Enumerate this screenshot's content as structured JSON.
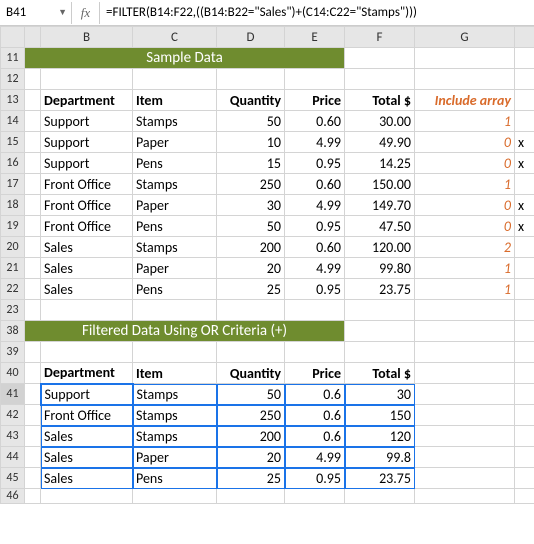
{
  "namebox": "B41",
  "formula": "=FILTER(B14:F22,((B14:B22=\"Sales\")+(C14:C22=\"Stamps\")))",
  "fx_label": "fx",
  "col_headers": [
    "B",
    "C",
    "D",
    "E",
    "F",
    "G"
  ],
  "banner1": "Sample Data",
  "banner2": "Filtered Data Using OR Criteria (+)",
  "headers": {
    "dept": "Department",
    "item": "Item",
    "qty": "Quantity",
    "price": "Price",
    "total": "Total $",
    "include": "Include array"
  },
  "sample": [
    {
      "row": "14",
      "dept": "Support",
      "item": "Stamps",
      "qty": "50",
      "price": "0.60",
      "total": "30.00",
      "incl": "1",
      "x": ""
    },
    {
      "row": "15",
      "dept": "Support",
      "item": "Paper",
      "qty": "10",
      "price": "4.99",
      "total": "49.90",
      "incl": "0",
      "x": "x"
    },
    {
      "row": "16",
      "dept": "Support",
      "item": "Pens",
      "qty": "15",
      "price": "0.95",
      "total": "14.25",
      "incl": "0",
      "x": "x"
    },
    {
      "row": "17",
      "dept": "Front Office",
      "item": "Stamps",
      "qty": "250",
      "price": "0.60",
      "total": "150.00",
      "incl": "1",
      "x": ""
    },
    {
      "row": "18",
      "dept": "Front Office",
      "item": "Paper",
      "qty": "30",
      "price": "4.99",
      "total": "149.70",
      "incl": "0",
      "x": "x"
    },
    {
      "row": "19",
      "dept": "Front Office",
      "item": "Pens",
      "qty": "50",
      "price": "0.95",
      "total": "47.50",
      "incl": "0",
      "x": "x"
    },
    {
      "row": "20",
      "dept": "Sales",
      "item": "Stamps",
      "qty": "200",
      "price": "0.60",
      "total": "120.00",
      "incl": "2",
      "x": ""
    },
    {
      "row": "21",
      "dept": "Sales",
      "item": "Paper",
      "qty": "20",
      "price": "4.99",
      "total": "99.80",
      "incl": "1",
      "x": ""
    },
    {
      "row": "22",
      "dept": "Sales",
      "item": "Pens",
      "qty": "25",
      "price": "0.95",
      "total": "23.75",
      "incl": "1",
      "x": ""
    }
  ],
  "filtered": [
    {
      "row": "41",
      "dept": "Support",
      "item": "Stamps",
      "qty": "50",
      "price": "0.6",
      "total": "30"
    },
    {
      "row": "42",
      "dept": "Front Office",
      "item": "Stamps",
      "qty": "250",
      "price": "0.6",
      "total": "150"
    },
    {
      "row": "43",
      "dept": "Sales",
      "item": "Stamps",
      "qty": "200",
      "price": "0.6",
      "total": "120"
    },
    {
      "row": "44",
      "dept": "Sales",
      "item": "Paper",
      "qty": "20",
      "price": "4.99",
      "total": "99.8"
    },
    {
      "row": "45",
      "dept": "Sales",
      "item": "Pens",
      "qty": "25",
      "price": "0.95",
      "total": "23.75"
    }
  ],
  "row_ids": {
    "banner1": "11",
    "blank1": "12",
    "hdr1": "13",
    "blank2": "23",
    "banner2": "38",
    "blank3": "39",
    "hdr2": "40",
    "blank4": "46"
  },
  "chart_data": {
    "type": "table",
    "title": "Sample Data / Filtered Data Using OR Criteria (+)",
    "tables": [
      {
        "name": "Sample Data",
        "columns": [
          "Department",
          "Item",
          "Quantity",
          "Price",
          "Total $",
          "Include array"
        ],
        "rows": [
          [
            "Support",
            "Stamps",
            50,
            0.6,
            30.0,
            1
          ],
          [
            "Support",
            "Paper",
            10,
            4.99,
            49.9,
            0
          ],
          [
            "Support",
            "Pens",
            15,
            0.95,
            14.25,
            0
          ],
          [
            "Front Office",
            "Stamps",
            250,
            0.6,
            150.0,
            1
          ],
          [
            "Front Office",
            "Paper",
            30,
            4.99,
            149.7,
            0
          ],
          [
            "Front Office",
            "Pens",
            50,
            0.95,
            47.5,
            0
          ],
          [
            "Sales",
            "Stamps",
            200,
            0.6,
            120.0,
            2
          ],
          [
            "Sales",
            "Paper",
            20,
            4.99,
            99.8,
            1
          ],
          [
            "Sales",
            "Pens",
            25,
            0.95,
            23.75,
            1
          ]
        ]
      },
      {
        "name": "Filtered Data Using OR Criteria (+)",
        "columns": [
          "Department",
          "Item",
          "Quantity",
          "Price",
          "Total $"
        ],
        "rows": [
          [
            "Support",
            "Stamps",
            50,
            0.6,
            30
          ],
          [
            "Front Office",
            "Stamps",
            250,
            0.6,
            150
          ],
          [
            "Sales",
            "Stamps",
            200,
            0.6,
            120
          ],
          [
            "Sales",
            "Paper",
            20,
            4.99,
            99.8
          ],
          [
            "Sales",
            "Pens",
            25,
            0.95,
            23.75
          ]
        ]
      }
    ]
  }
}
